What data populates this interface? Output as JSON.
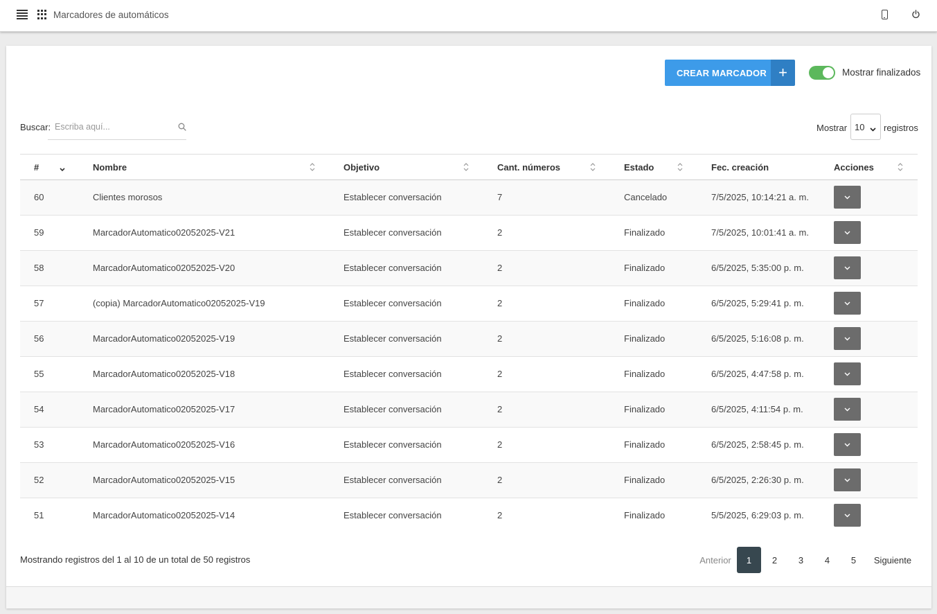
{
  "header": {
    "title": "Marcadores de automáticos",
    "icons": [
      "menu-icon",
      "apps-icon",
      "phone-icon",
      "power-icon"
    ]
  },
  "toolbar": {
    "create_label": "CREAR MARCADOR",
    "create_plus": "+",
    "toggle_label": "Mostrar finalizados",
    "toggle_on": true
  },
  "search": {
    "label": "Buscar:",
    "placeholder": "Escriba aquí...",
    "value": ""
  },
  "length": {
    "prefix": "Mostrar",
    "selected": "10",
    "suffix": "registros"
  },
  "table": {
    "columns": [
      "#",
      "Nombre",
      "Objetivo",
      "Cant. números",
      "Estado",
      "Fec. creación",
      "Acciones"
    ],
    "rows": [
      {
        "id": "60",
        "name": "Clientes morosos",
        "goal": "Establecer conversación",
        "count": "7",
        "status": "Cancelado",
        "created": "7/5/2025, 10:14:21 a. m."
      },
      {
        "id": "59",
        "name": "MarcadorAutomatico02052025-V21",
        "goal": "Establecer conversación",
        "count": "2",
        "status": "Finalizado",
        "created": "7/5/2025, 10:01:41 a. m."
      },
      {
        "id": "58",
        "name": "MarcadorAutomatico02052025-V20",
        "goal": "Establecer conversación",
        "count": "2",
        "status": "Finalizado",
        "created": "6/5/2025, 5:35:00 p. m."
      },
      {
        "id": "57",
        "name": "(copia) MarcadorAutomatico02052025-V19",
        "goal": "Establecer conversación",
        "count": "2",
        "status": "Finalizado",
        "created": "6/5/2025, 5:29:41 p. m."
      },
      {
        "id": "56",
        "name": "MarcadorAutomatico02052025-V19",
        "goal": "Establecer conversación",
        "count": "2",
        "status": "Finalizado",
        "created": "6/5/2025, 5:16:08 p. m."
      },
      {
        "id": "55",
        "name": "MarcadorAutomatico02052025-V18",
        "goal": "Establecer conversación",
        "count": "2",
        "status": "Finalizado",
        "created": "6/5/2025, 4:47:58 p. m."
      },
      {
        "id": "54",
        "name": "MarcadorAutomatico02052025-V17",
        "goal": "Establecer conversación",
        "count": "2",
        "status": "Finalizado",
        "created": "6/5/2025, 4:11:54 p. m."
      },
      {
        "id": "53",
        "name": "MarcadorAutomatico02052025-V16",
        "goal": "Establecer conversación",
        "count": "2",
        "status": "Finalizado",
        "created": "6/5/2025, 2:58:45 p. m."
      },
      {
        "id": "52",
        "name": "MarcadorAutomatico02052025-V15",
        "goal": "Establecer conversación",
        "count": "2",
        "status": "Finalizado",
        "created": "6/5/2025, 2:26:30 p. m."
      },
      {
        "id": "51",
        "name": "MarcadorAutomatico02052025-V14",
        "goal": "Establecer conversación",
        "count": "2",
        "status": "Finalizado",
        "created": "5/5/2025, 6:29:03 p. m."
      }
    ]
  },
  "footer": {
    "info": "Mostrando registros del 1 al 10 de un total de 50 registros",
    "prev": "Anterior",
    "pages": [
      "1",
      "2",
      "3",
      "4",
      "5"
    ],
    "active_page": "1",
    "next": "Siguiente"
  },
  "colors": {
    "primary": "#3d9be9",
    "primary_dark": "#2f7fc4",
    "toggle_on": "#5cb85c",
    "action_button": "#6c6c6c",
    "active_page": "#37474f"
  }
}
